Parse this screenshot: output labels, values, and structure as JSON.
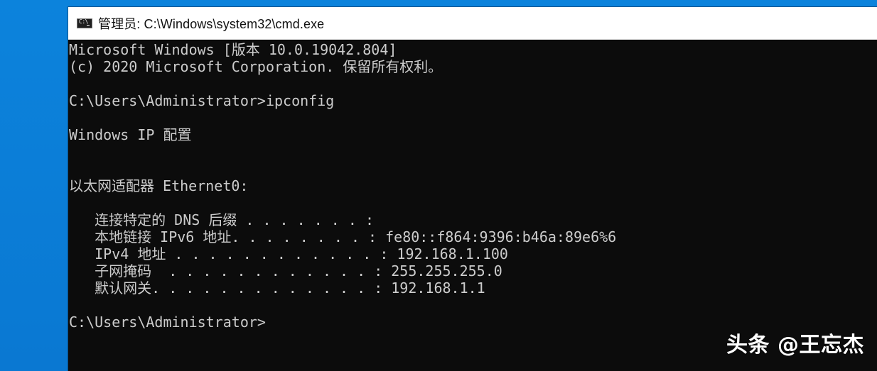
{
  "desktop": {
    "background_color": "#0c83dc"
  },
  "window": {
    "title": "管理员: C:\\Windows\\system32\\cmd.exe",
    "icon": "cmd-icon"
  },
  "console": {
    "lines": [
      "Microsoft Windows [版本 10.0.19042.804]",
      "(c) 2020 Microsoft Corporation. 保留所有权利。",
      "",
      "C:\\Users\\Administrator>ipconfig",
      "",
      "Windows IP 配置",
      "",
      "",
      "以太网适配器 Ethernet0:",
      "",
      "   连接特定的 DNS 后缀 . . . . . . . :",
      "   本地链接 IPv6 地址. . . . . . . . : fe80::f864:9396:b46a:89e6%6",
      "   IPv4 地址 . . . . . . . . . . . . : 192.168.1.100",
      "   子网掩码  . . . . . . . . . . . . : 255.255.255.0",
      "   默认网关. . . . . . . . . . . . . : 192.168.1.1",
      "",
      "C:\\Users\\Administrator>"
    ],
    "text_color": "#cccccc",
    "background_color": "#0c0c0c"
  },
  "watermark": {
    "text": "头条 @王忘杰"
  }
}
